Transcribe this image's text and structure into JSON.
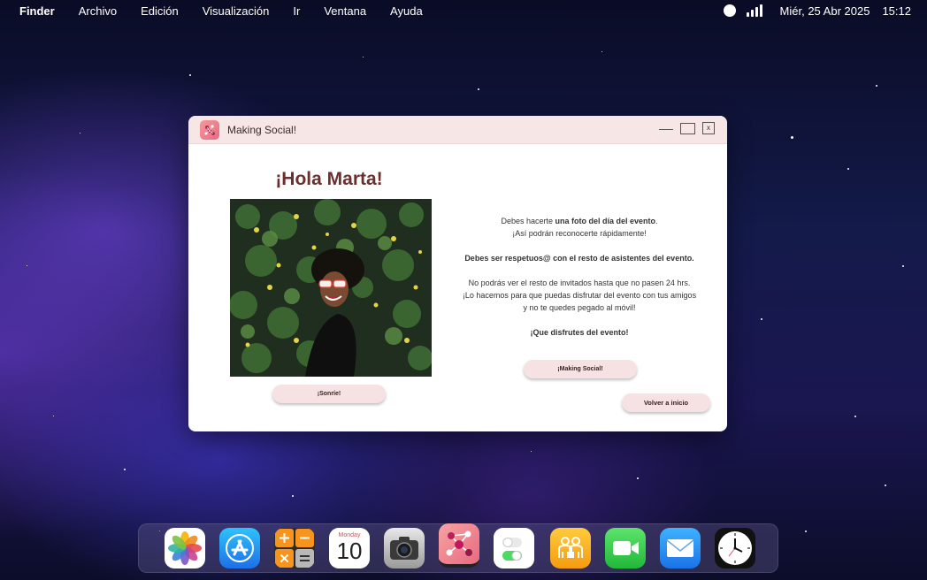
{
  "menubar": {
    "app_name": "Finder",
    "menus": [
      "Archivo",
      "Edición",
      "Visualización",
      "Ir",
      "Ventana",
      "Ayuda"
    ],
    "date": "Miér, 25 Abr 2025",
    "time": "15:12"
  },
  "window": {
    "title": "Making Social!",
    "close_label": "x",
    "greeting": "¡Hola Marta!",
    "smile_button": "¡Sonríe!",
    "info": {
      "line1_pre": "Debes hacerte ",
      "line1_bold": "una foto del día del evento",
      "line1_post": ".",
      "line2": "¡Así podrán reconocerte rápidamente!",
      "line3": "Debes ser respetuos@ con el resto de asistentes del evento.",
      "line4": "No podrás ver el resto de invitados hasta que no pasen 24 hrs.",
      "line5": "¡Lo hacemos para que puedas disfrutar del evento con tus amigos",
      "line6": "y no te quedes pegado al móvil!",
      "line7": "¡Que disfrutes del evento!"
    },
    "social_button": "¡Making Social!",
    "back_button": "Volver a inicio"
  },
  "dock": {
    "calendar_month": "Monday",
    "calendar_day": "10",
    "apps": [
      "photos-icon",
      "app-store-icon",
      "calculator-icon",
      "calendar-icon",
      "camera-icon",
      "making-social-icon",
      "toggles-icon",
      "find-friends-icon",
      "facetime-icon",
      "mail-icon",
      "clock-icon"
    ]
  },
  "colors": {
    "accent": "#6b2f2f",
    "titlebar": "#f6e6e6",
    "button": "#f6e2e2"
  }
}
